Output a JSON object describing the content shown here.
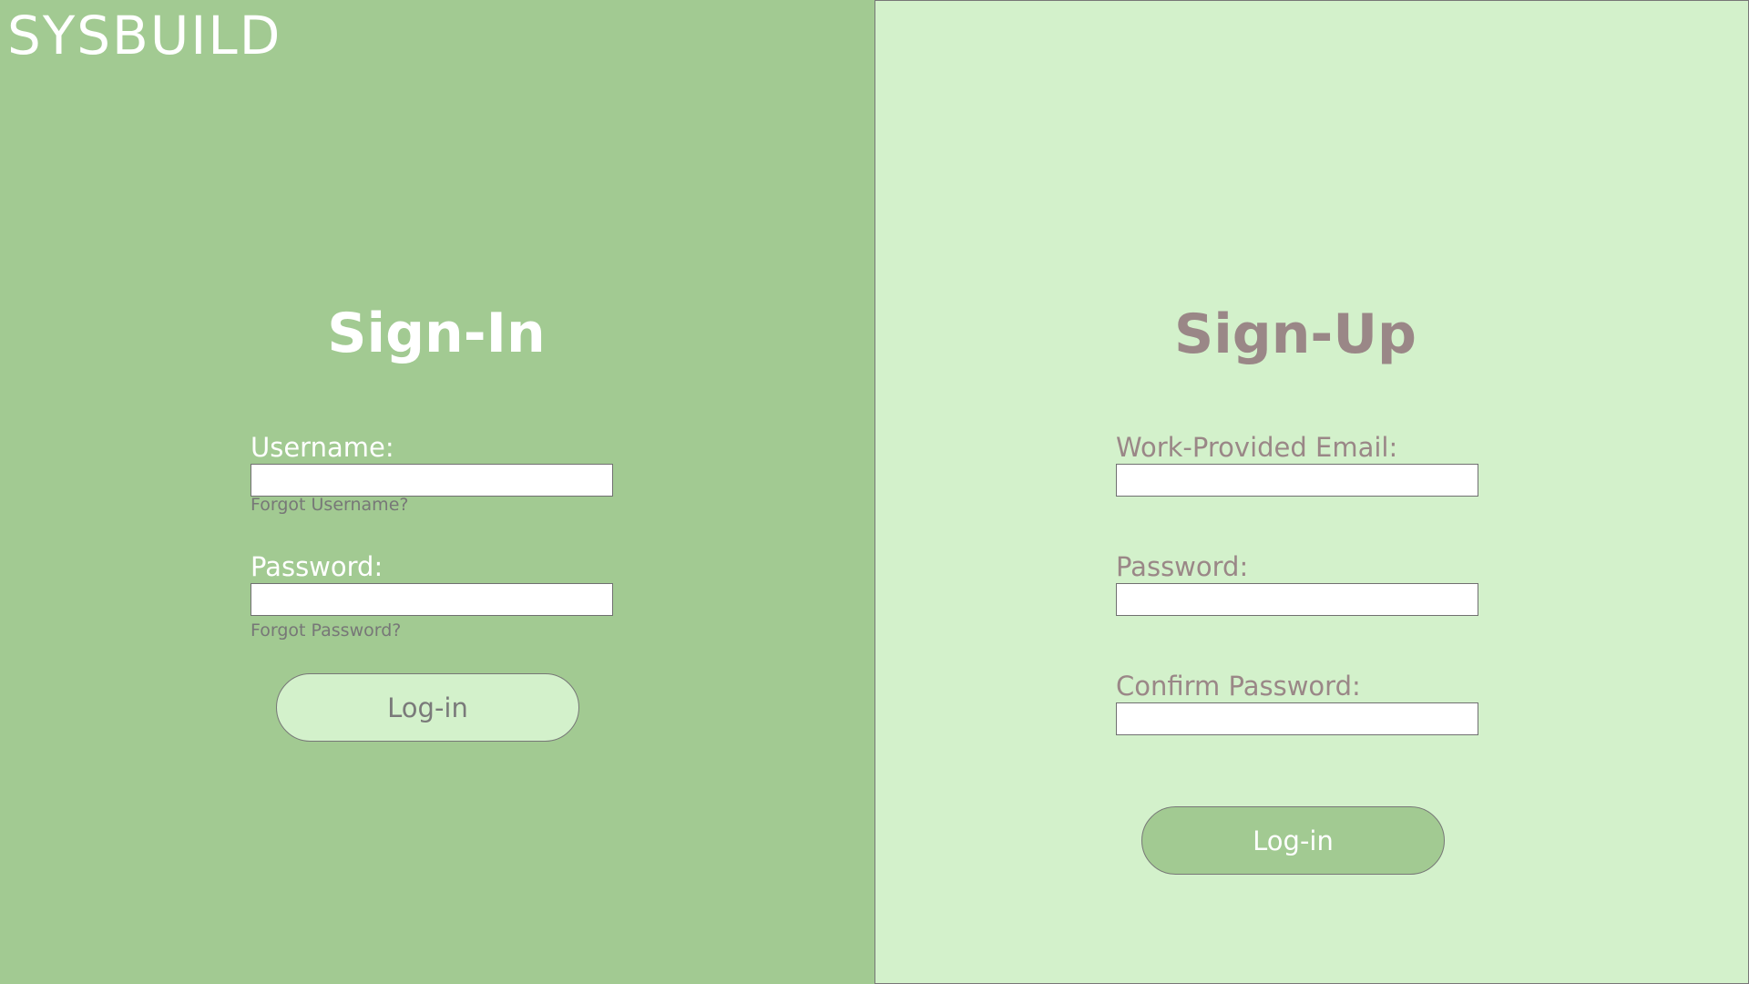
{
  "brand": {
    "name": "SYSBUILD"
  },
  "sign_in": {
    "title": "Sign-In",
    "username_label": "Username:",
    "username_value": "",
    "forgot_username": "Forgot Username?",
    "password_label": "Password:",
    "password_value": "",
    "forgot_password": "Forgot Password?",
    "submit_label": "Log-in"
  },
  "sign_up": {
    "title": "Sign-Up",
    "email_label": "Work-Provided Email:",
    "email_value": "",
    "password_label": "Password:",
    "password_value": "",
    "confirm_label": "Confirm Password:",
    "confirm_value": "",
    "submit_label": "Log-in"
  },
  "colors": {
    "left_panel_bg": "#a2ca92",
    "right_panel_bg": "#d3f1cb",
    "muted_text": "#9a8787",
    "link_text": "#777777"
  }
}
